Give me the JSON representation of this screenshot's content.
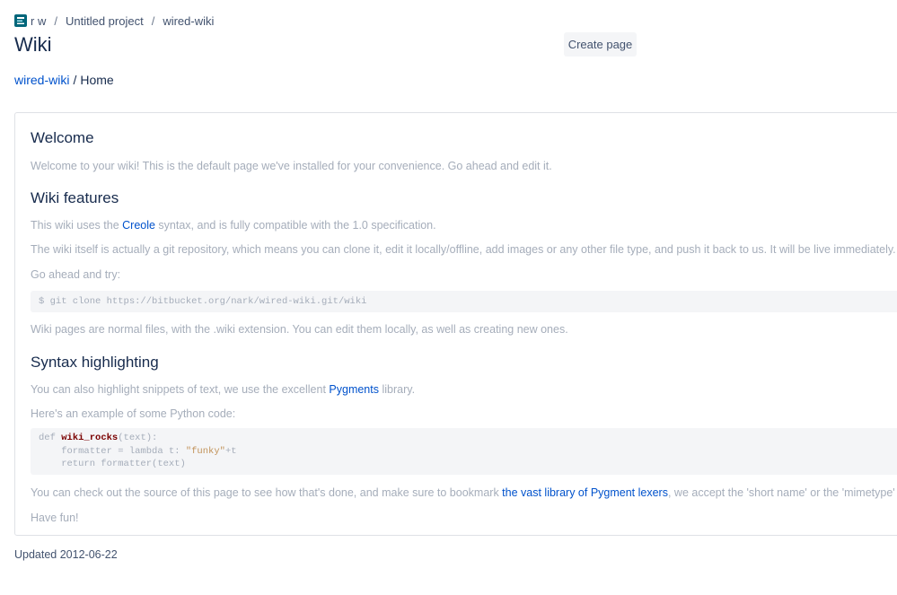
{
  "breadcrumb": {
    "items": [
      "r w",
      "Untitled project",
      "wired-wiki"
    ],
    "separator": "/"
  },
  "header": {
    "title": "Wiki",
    "create_button": "Create page"
  },
  "wiki_path": {
    "repo": "wired-wiki",
    "separator": "/",
    "page": "Home"
  },
  "content": {
    "h_welcome": "Welcome",
    "p_welcome": "Welcome to your wiki! This is the default page we've installed for your convenience. Go ahead and edit it.",
    "h_features": "Wiki features",
    "p_creole_before": "This wiki uses the ",
    "p_creole_link": "Creole",
    "p_creole_after": " syntax, and is fully compatible with the 1.0 specification.",
    "p_git": "The wiki itself is actually a git repository, which means you can clone it, edit it locally/offline, add images or any other file type, and push it back to us. It will be live immediately.",
    "p_try": "Go ahead and try:",
    "code_clone": "$ git clone https://bitbucket.org/nark/wired-wiki.git/wiki",
    "p_pages": "Wiki pages are normal files, with the .wiki extension. You can edit them locally, as well as creating new ones.",
    "h_syntax": "Syntax highlighting",
    "p_highlight_before": "You can also highlight snippets of text, we use the excellent ",
    "p_highlight_link": "Pygments",
    "p_highlight_after": " library.",
    "p_example": "Here's an example of some Python code:",
    "code_py": {
      "kw_def": "def ",
      "fn_name": "wiki_rocks",
      "sig": "(text):",
      "line2_a": "    formatter = lambda t: ",
      "line2_str": "\"funky\"",
      "line2_b": "+t",
      "line3": "    return formatter(text)"
    },
    "p_source_before": "You can check out the source of this page to see how that's done, and make sure to bookmark ",
    "p_source_link": "the vast library of Pygment lexers",
    "p_source_after": ", we accept the 'short name' or the 'mimetype' of anyt",
    "p_fun": "Have fun!"
  },
  "footer": {
    "updated": "Updated 2012-06-22"
  },
  "colors": {
    "link": "#0052cc",
    "muted_text": "#a5adba",
    "heading": "#172b4d"
  }
}
